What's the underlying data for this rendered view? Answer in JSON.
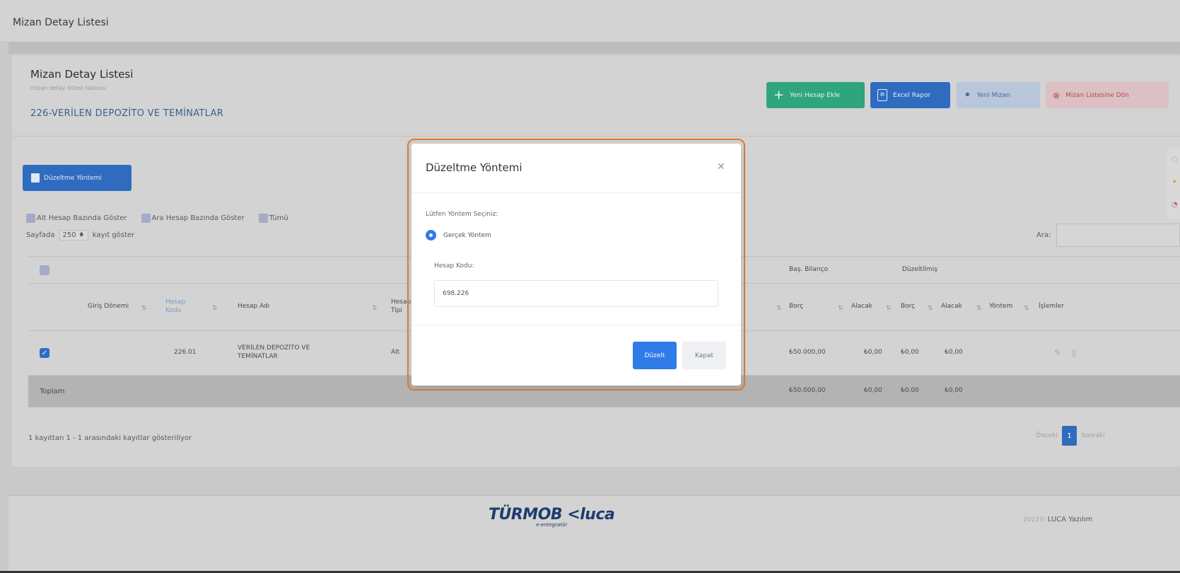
{
  "page": {
    "title": "Mizan Detay Listesi"
  },
  "card": {
    "title": "Mizan Detay Listesi",
    "subtitle": "mizan detay listesi tablosu",
    "account": "226-VERİLEN DEPOZİTO VE TEMİNATLAR"
  },
  "header_buttons": {
    "new_account": "Yeni Hesap Ekle",
    "excel": "Excel Rapor",
    "new_mizan": "Yeni Mizan",
    "back": "Mizan Listesine Dön"
  },
  "fix_button": "Düzeltme Yöntemi",
  "filters": {
    "alt": "Alt Hesap Bazında Göster",
    "ara": "Ara Hesap Bazında Göster",
    "tumu": "Tümü"
  },
  "pagesize": {
    "prefix": "Sayfada",
    "value": "250 ♦",
    "suffix": "kayıt göster"
  },
  "search": {
    "label": "Ara:"
  },
  "table": {
    "groups": {
      "bas_bilanco": "Baş. Bilanço",
      "duzeltilmis": "Düzeltilmiş"
    },
    "columns": {
      "giris_donemi": "Giriş Dönemi",
      "hesap_kodu": "Hesap Kodu",
      "hesap_adi": "Hesap Adı",
      "hesap_tipi": "Hesap Tipi",
      "borc": "Borç",
      "alacak": "Alacak",
      "d_borc": "Borç",
      "d_alacak": "Alacak",
      "yontem": "Yöntem",
      "islemler": "İşlemler"
    },
    "row": {
      "giris_donemi": "",
      "hesap_kodu": "226.01",
      "hesap_adi": "VERİLEN DEPOZİTO VE TEMİNATLAR",
      "hesap_tipi": "Alt",
      "borc": "₺50.000,00",
      "alacak": "₺0,00",
      "d_borc": "₺0,00",
      "d_alacak": "₺0,00",
      "yontem": ""
    },
    "total": {
      "label": "Toplam",
      "borc": "₺50.000,00",
      "alacak": "₺0,00",
      "d_borc": "₺0,00",
      "d_alacak": "₺0,00"
    }
  },
  "info": "1 kayıttan 1 - 1 arasındaki kayıtlar gösteriliyor",
  "pager": {
    "prev": "Önceki",
    "current": "1",
    "next": "Sonraki"
  },
  "footer": {
    "logo": "TÜRMOB <luca",
    "logo_sub": "e-entegratör",
    "copy_year": "2023©",
    "copy_name": "LUCA Yazılım"
  },
  "modal": {
    "title": "Düzeltme Yöntemi",
    "prompt": "Lütfen Yöntem Seçiniz:",
    "option": "Gerçek Yöntem",
    "hesap_kodu_label": "Hesap Kodu:",
    "hesap_kodu_value": "698.226",
    "submit": "Düzelt",
    "close": "Kapat"
  },
  "colors": {
    "accent": "#2f7be8",
    "green": "#2ea57e",
    "frame": "#e07b2c"
  }
}
